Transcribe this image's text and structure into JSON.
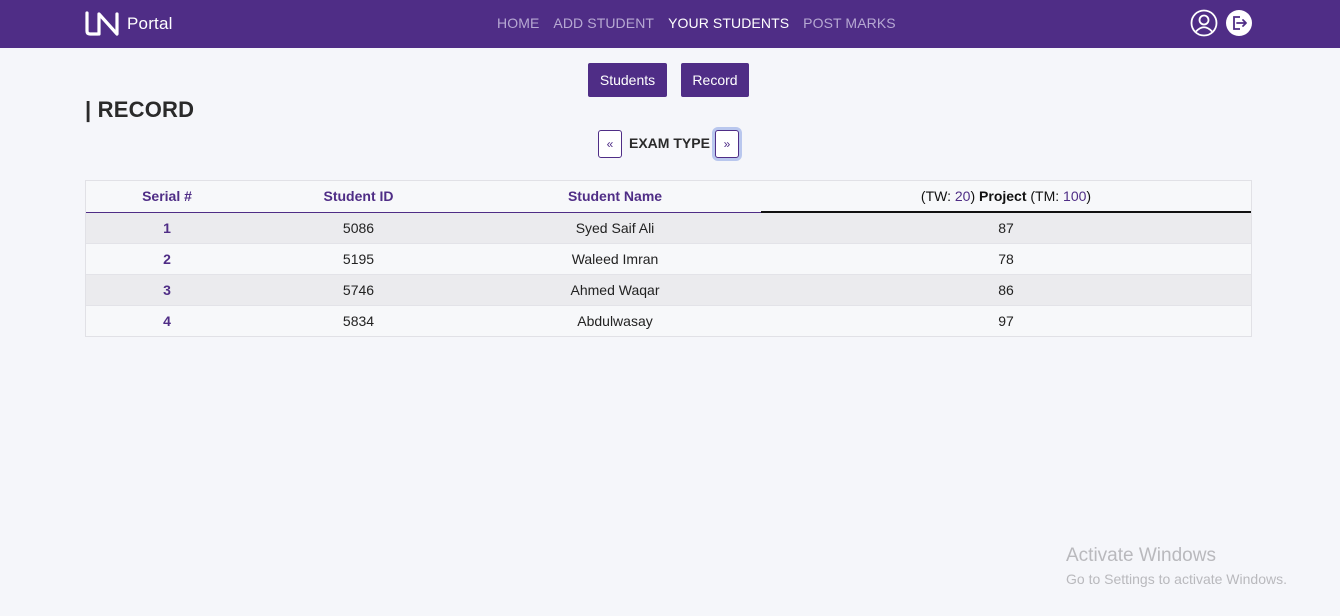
{
  "nav": {
    "brand_text": "Portal",
    "links": [
      {
        "label": "HOME"
      },
      {
        "label": "ADD STUDENT"
      },
      {
        "label": "YOUR STUDENTS"
      },
      {
        "label": "POST MARKS"
      }
    ],
    "active": "YOUR STUDENTS",
    "icons": [
      "user-circle-icon",
      "logout-icon"
    ],
    "color": "#4f2d86"
  },
  "buttons": {
    "students": "Students",
    "record": "Record"
  },
  "page": {
    "title": "| RECORD"
  },
  "exam_selector": {
    "prev": "«",
    "label": "EXAM TYPE",
    "next": "»"
  },
  "table": {
    "headers": {
      "serial": "Serial #",
      "student_id": "Student ID",
      "student_name": "Student Name",
      "marks": {
        "tw_prefix": "(TW: ",
        "tw": "20",
        "tw_suffix": ")",
        "exam": "Project",
        "tm_prefix": "(TM: ",
        "tm": "100",
        "tm_suffix": ")"
      }
    },
    "rows": [
      {
        "serial": "1",
        "id": "5086",
        "name": "Syed Saif Ali",
        "marks": "87"
      },
      {
        "serial": "2",
        "id": "5195",
        "name": "Waleed Imran",
        "marks": "78"
      },
      {
        "serial": "3",
        "id": "5746",
        "name": "Ahmed Waqar",
        "marks": "86"
      },
      {
        "serial": "4",
        "id": "5834",
        "name": "Abdulwasay",
        "marks": "97"
      }
    ]
  },
  "watermark": {
    "title": "Activate Windows",
    "subtitle": "Go to Settings to activate Windows."
  }
}
